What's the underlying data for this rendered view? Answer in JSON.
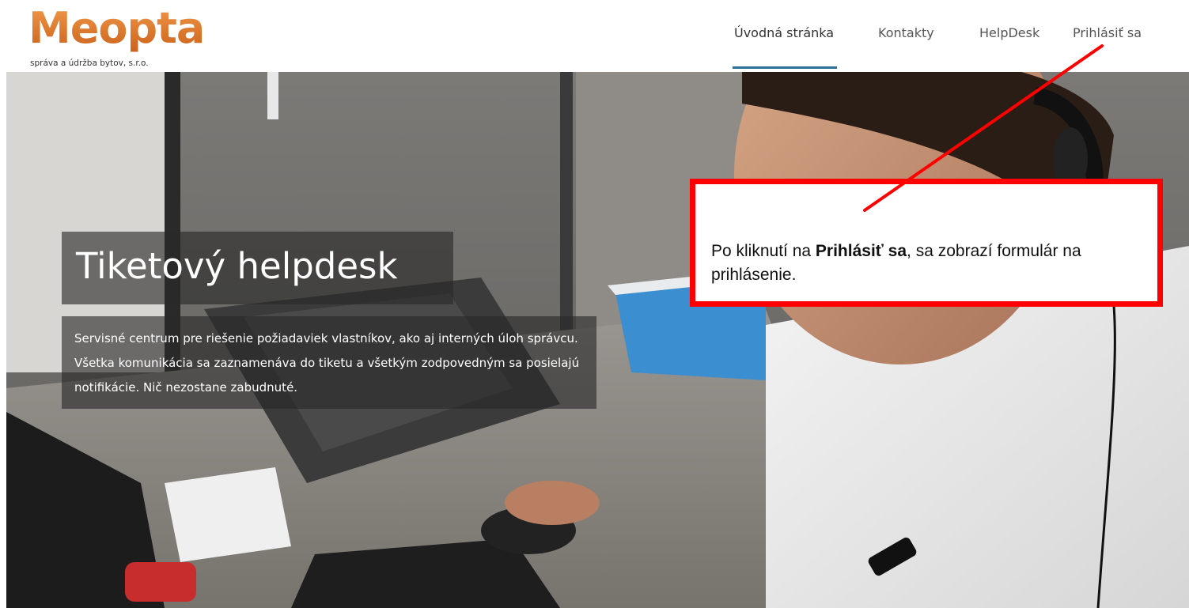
{
  "brand": {
    "name": "Meopta",
    "tagline": "správa a údržba bytov, s.r.o."
  },
  "nav": {
    "items": [
      {
        "label": "Úvodná stránka",
        "active": true
      },
      {
        "label": "Kontakty",
        "active": false
      },
      {
        "label": "HelpDesk",
        "active": false
      },
      {
        "label": "Prihlásiť sa",
        "active": false
      }
    ]
  },
  "hero": {
    "title": "Tiketový helpdesk",
    "subtitle": "Servisné centrum pre riešenie požiadaviek vlastníkov, ako aj interných úloh správcu. Všetka komunikácia sa zaznamenáva do tiketu a všetkým zodpovedným sa posielajú notifikácie. Nič nezostane zabudnuté.",
    "image": "helpdesk-operator-photo"
  },
  "annotation": {
    "text_before": "Po kliknutí na ",
    "text_bold": "Prihlásiť sa",
    "text_after": ", sa zobrazí formulár na prihlásenie.",
    "border_color": "#ff0000"
  },
  "colors": {
    "brand_orange": "#e07a28",
    "nav_active_underline": "#2c6f9a",
    "annotation_red": "#ff0000"
  }
}
